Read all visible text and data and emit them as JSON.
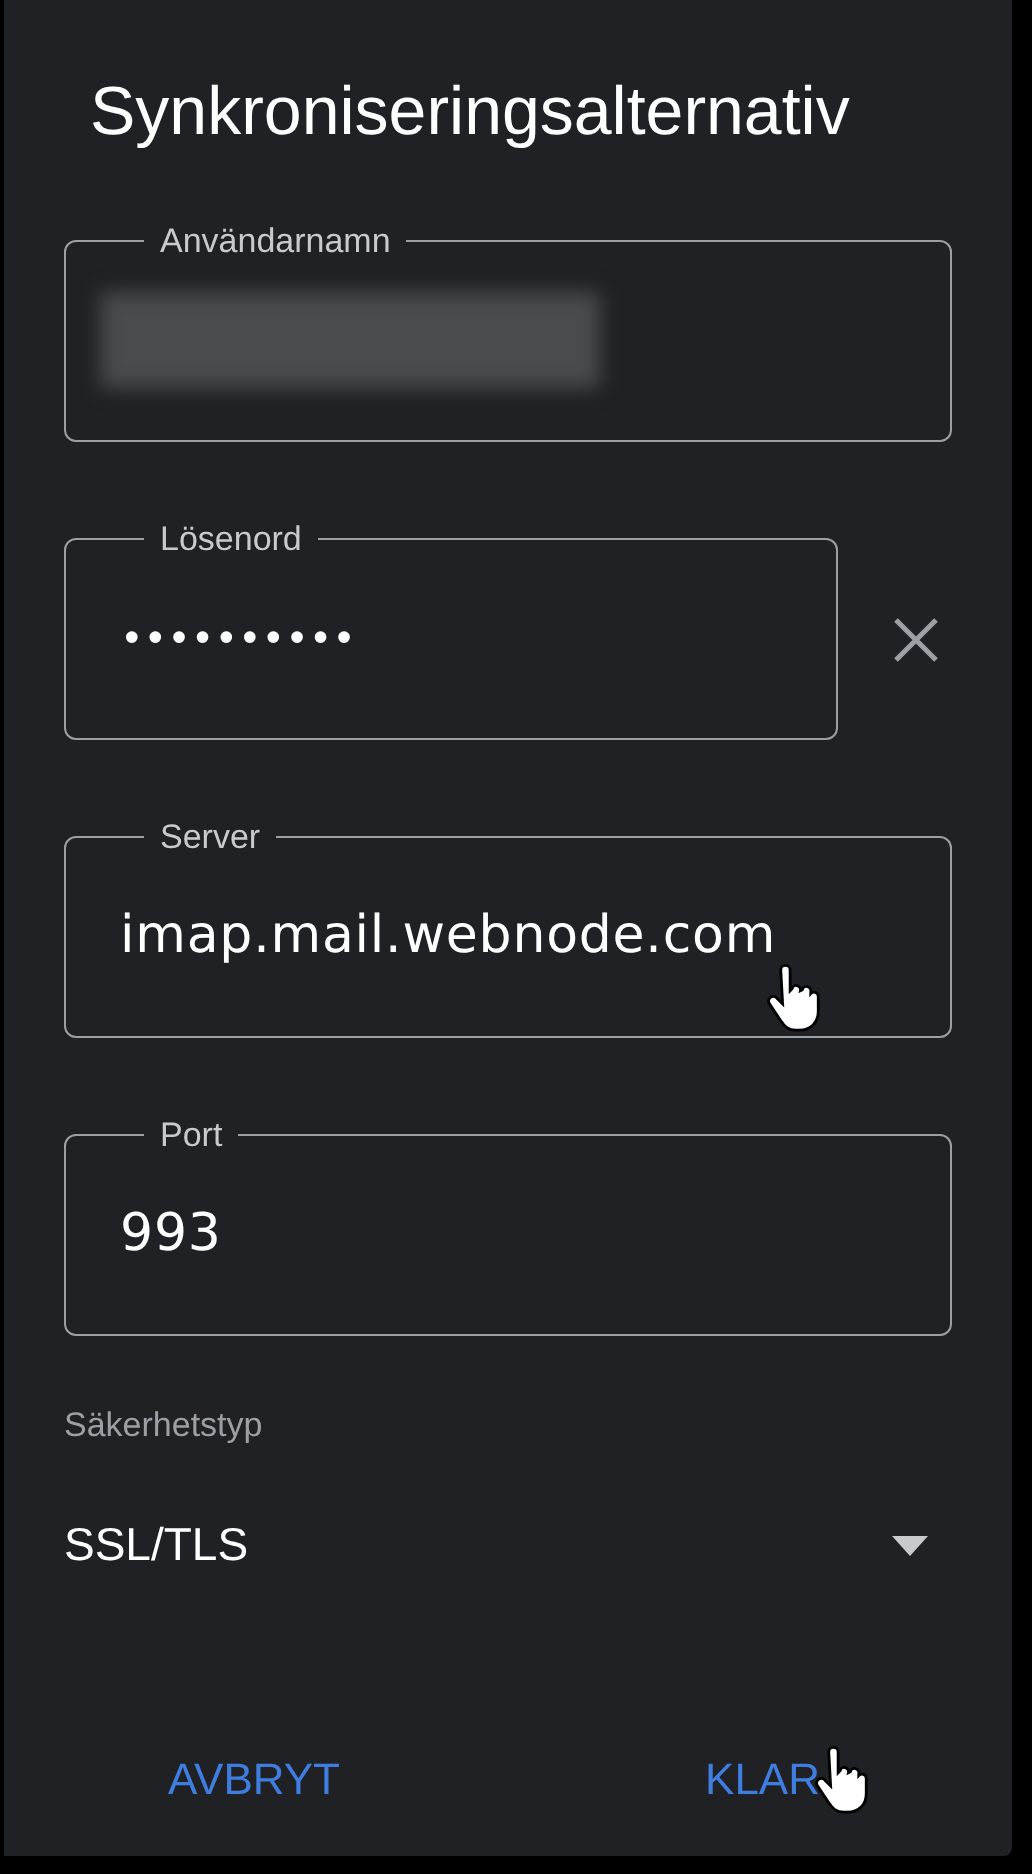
{
  "dialog": {
    "title": "Synkroniseringsalternativ"
  },
  "fields": [
    {
      "label": "Användarnamn",
      "kind": "redacted",
      "clearable": false,
      "pointer": false
    },
    {
      "label": "Lösenord",
      "kind": "password",
      "value": "••••••••••",
      "clearable": true,
      "pointer": false
    },
    {
      "label": "Server",
      "kind": "text",
      "value": "imap.mail.webnode.com",
      "clearable": false,
      "pointer": true
    },
    {
      "label": "Port",
      "kind": "text",
      "value": "993",
      "clearable": false,
      "pointer": false
    }
  ],
  "security": {
    "label": "Säkerhetstyp",
    "value": "SSL/TLS"
  },
  "buttons": [
    {
      "label": "AVBRYT",
      "pointer": false
    },
    {
      "label": "KLAR",
      "pointer": true
    }
  ]
}
